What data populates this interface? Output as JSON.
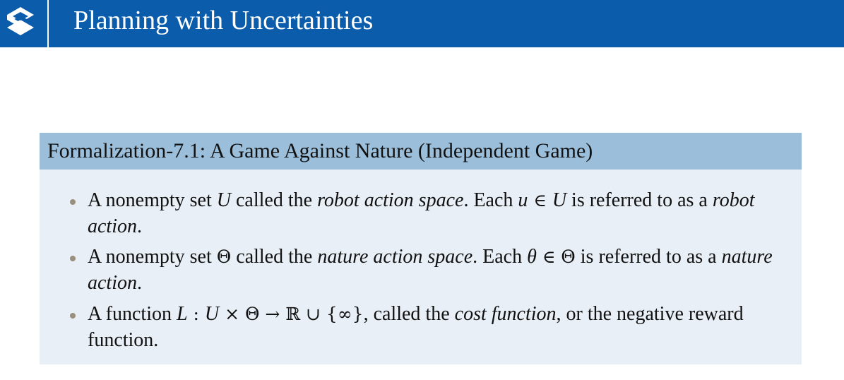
{
  "header": {
    "title": "Planning with Uncertainties",
    "logo_icon": "stacked-chevrons-logo",
    "background": "#0b5cab"
  },
  "box": {
    "title": "Formalization-7.1: A Game Against Nature (Independent Game)",
    "header_color": "#9bbfda",
    "body_color": "#e9eff6",
    "items": [
      {
        "t1": "A nonempty set ",
        "m1": "U",
        "t2": " called the ",
        "e1": "robot action space",
        "t3": ". Each ",
        "m2": "u",
        "s1": " ∈ ",
        "m3": "U",
        "t4": " is referred to as a ",
        "e2": "robot action",
        "t5": "."
      },
      {
        "t1": "A nonempty set ",
        "m1": "Θ",
        "t2": " called the ",
        "e1": "nature action space",
        "t3": ". Each ",
        "m2": "θ",
        "s1": " ∈ ",
        "m3": "Θ",
        "t4": " is referred to as a ",
        "e2": "nature action",
        "t5": "."
      },
      {
        "t1": "A function ",
        "m1": "L",
        "s1": " : ",
        "m2": "U",
        "s2": " × Θ → ℝ ∪ {∞}",
        "t2": ", called the ",
        "e1": "cost function",
        "t3": ", or the negative reward function."
      }
    ]
  }
}
